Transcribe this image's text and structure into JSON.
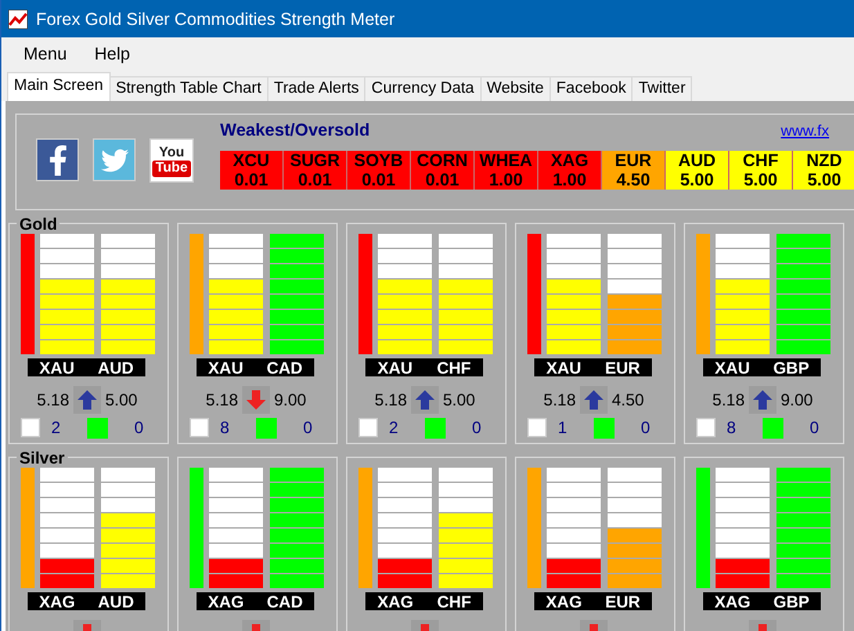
{
  "window": {
    "title": "Forex Gold Silver Commodities Strength Meter"
  },
  "menu": [
    "Menu",
    "Help"
  ],
  "tabs": [
    {
      "label": "Main Screen",
      "selected": true
    },
    {
      "label": "Strength Table Chart",
      "selected": false
    },
    {
      "label": "Trade Alerts",
      "selected": false
    },
    {
      "label": "Currency Data",
      "selected": false
    },
    {
      "label": "Website",
      "selected": false
    },
    {
      "label": "Facebook",
      "selected": false
    },
    {
      "label": "Twitter",
      "selected": false
    }
  ],
  "youtube_logo": [
    "You",
    "Tube"
  ],
  "strength_table": {
    "title": "Weakest/Oversold",
    "link": "www.fx",
    "cells": [
      {
        "symbol": "XCU",
        "value": "0.01",
        "color": "#ff0000"
      },
      {
        "symbol": "SUGR",
        "value": "0.01",
        "color": "#ff0000"
      },
      {
        "symbol": "SOYB",
        "value": "0.01",
        "color": "#ff0000"
      },
      {
        "symbol": "CORN",
        "value": "0.01",
        "color": "#ff0000"
      },
      {
        "symbol": "WHEA",
        "value": "1.00",
        "color": "#ff0000"
      },
      {
        "symbol": "XAG",
        "value": "1.00",
        "color": "#ff0000"
      },
      {
        "symbol": "EUR",
        "value": "4.50",
        "color": "#ffa500"
      },
      {
        "symbol": "AUD",
        "value": "5.00",
        "color": "#ffff00"
      },
      {
        "symbol": "CHF",
        "value": "5.00",
        "color": "#ffff00"
      },
      {
        "symbol": "NZD",
        "value": "5.00",
        "color": "#ffff00"
      }
    ]
  },
  "groups": [
    {
      "name": "Gold",
      "pairs": [
        {
          "color": "#ff0000",
          "columns": [
            {
              "label": "XAU",
              "level": 0.625,
              "color": "#ffff00"
            },
            {
              "label": "AUD",
              "level": 0.625,
              "color": "#ffff00"
            }
          ],
          "base_value": "5.18",
          "kind": "up",
          "quote_value": "5.00",
          "checked": false,
          "count": "2",
          "signals": "0"
        },
        {
          "color": "#ffa500",
          "columns": [
            {
              "label": "XAU",
              "level": 0.625,
              "color": "#ffff00"
            },
            {
              "label": "CAD",
              "level": 1,
              "color": "#00ff00"
            }
          ],
          "base_value": "5.18",
          "kind": "down",
          "quote_value": "9.00",
          "checked": false,
          "count": "8",
          "signals": "0"
        },
        {
          "color": "#ff0000",
          "columns": [
            {
              "label": "XAU",
              "level": 0.625,
              "color": "#ffff00"
            },
            {
              "label": "CHF",
              "level": 0.625,
              "color": "#ffff00"
            }
          ],
          "base_value": "5.18",
          "kind": "up",
          "quote_value": "5.00",
          "checked": false,
          "count": "2",
          "signals": "0"
        },
        {
          "color": "#ff0000",
          "columns": [
            {
              "label": "XAU",
              "level": 0.625,
              "color": "#ffff00"
            },
            {
              "label": "EUR",
              "level": 0.5,
              "color": "#ffa500"
            }
          ],
          "base_value": "5.18",
          "kind": "up",
          "quote_value": "4.50",
          "checked": false,
          "count": "1",
          "signals": "0"
        },
        {
          "color": "#ffa500",
          "columns": [
            {
              "label": "XAU",
              "level": 0.625,
              "color": "#ffff00"
            },
            {
              "label": "GBP",
              "level": 1,
              "color": "#00ff00"
            }
          ],
          "base_value": "5.18",
          "kind": "up",
          "quote_value": "9.00",
          "checked": false,
          "count": "8",
          "signals": "0"
        }
      ]
    },
    {
      "name": "Silver",
      "pairs": [
        {
          "color": "#ffa500",
          "columns": [
            {
              "label": "XAG",
              "level": 0.25,
              "color": "#ff0000"
            },
            {
              "label": "AUD",
              "level": 0.625,
              "color": "#ffff00"
            }
          ],
          "kind": "down"
        },
        {
          "color": "#00ff00",
          "columns": [
            {
              "label": "XAG",
              "level": 0.25,
              "color": "#ff0000"
            },
            {
              "label": "CAD",
              "level": 1,
              "color": "#00ff00"
            }
          ],
          "kind": "down"
        },
        {
          "color": "#ffa500",
          "columns": [
            {
              "label": "XAG",
              "level": 0.25,
              "color": "#ff0000"
            },
            {
              "label": "CHF",
              "level": 0.625,
              "color": "#ffff00"
            }
          ],
          "kind": "down"
        },
        {
          "color": "#ffa500",
          "columns": [
            {
              "label": "XAG",
              "level": 0.25,
              "color": "#ff0000"
            },
            {
              "label": "EUR",
              "level": 0.5,
              "color": "#ffa500"
            }
          ],
          "kind": "down"
        },
        {
          "color": "#00ff00",
          "columns": [
            {
              "label": "XAG",
              "level": 0.25,
              "color": "#ff0000"
            },
            {
              "label": "GBP",
              "level": 1,
              "color": "#00ff00"
            }
          ],
          "kind": "down"
        }
      ]
    }
  ]
}
